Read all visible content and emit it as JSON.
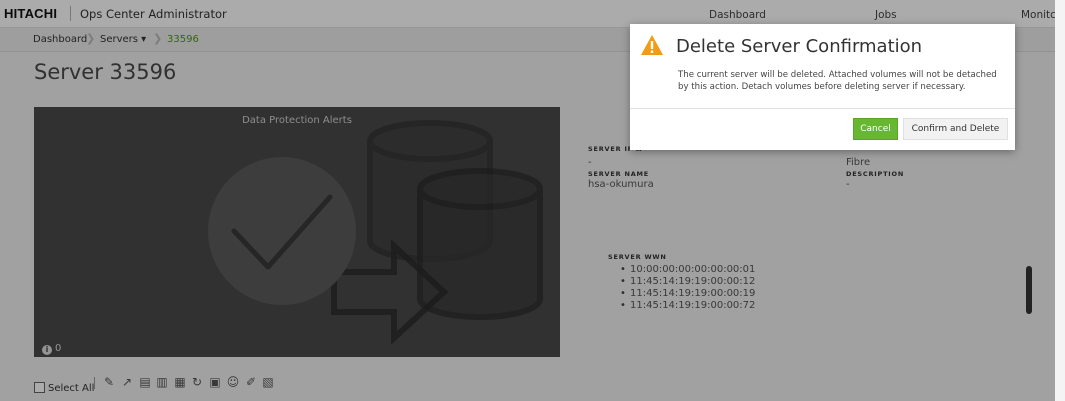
{
  "header": {
    "brand": "HITACHI",
    "app_title": "Ops Center Administrator",
    "nav": [
      "Dashboard",
      "Jobs",
      "Monitc"
    ]
  },
  "breadcrumb": {
    "items": [
      "Dashboard",
      "Servers ▾",
      "33596"
    ]
  },
  "page": {
    "title": "Server 33596"
  },
  "alerts_panel": {
    "title": "Data Protection Alerts",
    "count": "0"
  },
  "details": {
    "server_ip_label": "SERVER IP A",
    "server_ip_value": "-",
    "protocol_value": "Fibre",
    "server_name_label": "SERVER NAME",
    "server_name_value": "hsa-okumura",
    "description_label": "DESCRIPTION",
    "description_value": "-",
    "wwn_label": "SERVER WWN",
    "wwns": [
      "10:00:00:00:00:00:00:01",
      "11:45:14:19:19:00:00:12",
      "11:45:14:19:19:00:00:19",
      "11:45:14:19:19:00:00:72"
    ]
  },
  "toolbar": {
    "select_all": "Select All",
    "icons": [
      "pencil-icon",
      "attach-volume-icon",
      "detach-volume-icon",
      "volume-copy-icon",
      "delete-server-icon",
      "refresh-icon",
      "protect-icon",
      "user-group-icon",
      "edit-host-icon",
      "database-icon"
    ]
  },
  "dialog": {
    "title": "Delete Server Confirmation",
    "message": "The current server will be deleted. Attached volumes will not be detached by this action. Detach volumes before deleting server if necessary.",
    "cancel_label": "Cancel",
    "confirm_label": "Confirm and Delete"
  },
  "colors": {
    "accent_green": "#67b830",
    "warning_orange": "#f39c12",
    "panel_dark": "#4a4a4a"
  }
}
